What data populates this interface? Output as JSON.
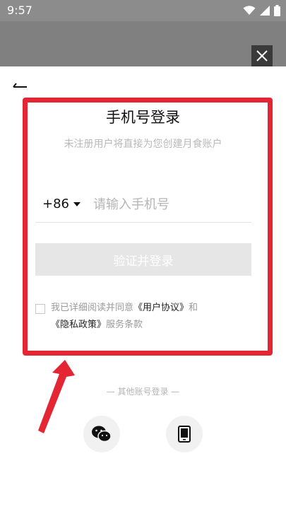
{
  "status_bar": {
    "time": "9:57",
    "icons": [
      "wifi-icon",
      "cell-signal-icon",
      "battery-icon"
    ]
  },
  "dialog": {
    "close_icon": "close-icon",
    "back_icon": "back-arrow-icon"
  },
  "login": {
    "title": "手机号登录",
    "subtitle": "未注册用户将直接为您创建月食账户",
    "country_code": "+86",
    "phone_placeholder": "请输入手机号",
    "phone_value": "",
    "submit_label": "验证并登录",
    "agree_prefix": "我已详细阅读并同意",
    "user_agreement": "《用户协议》",
    "agree_and": "和",
    "privacy_policy": "《隐私政策》",
    "agree_suffix": "服务条款",
    "agree_checked": false
  },
  "other_login": {
    "label": "—  其他账号登录  —",
    "options": [
      "wechat-icon",
      "phone-device-icon"
    ]
  },
  "colors": {
    "highlight": "#e42533",
    "button_disabled": "#e6e6e6",
    "overlay": "#808080"
  }
}
